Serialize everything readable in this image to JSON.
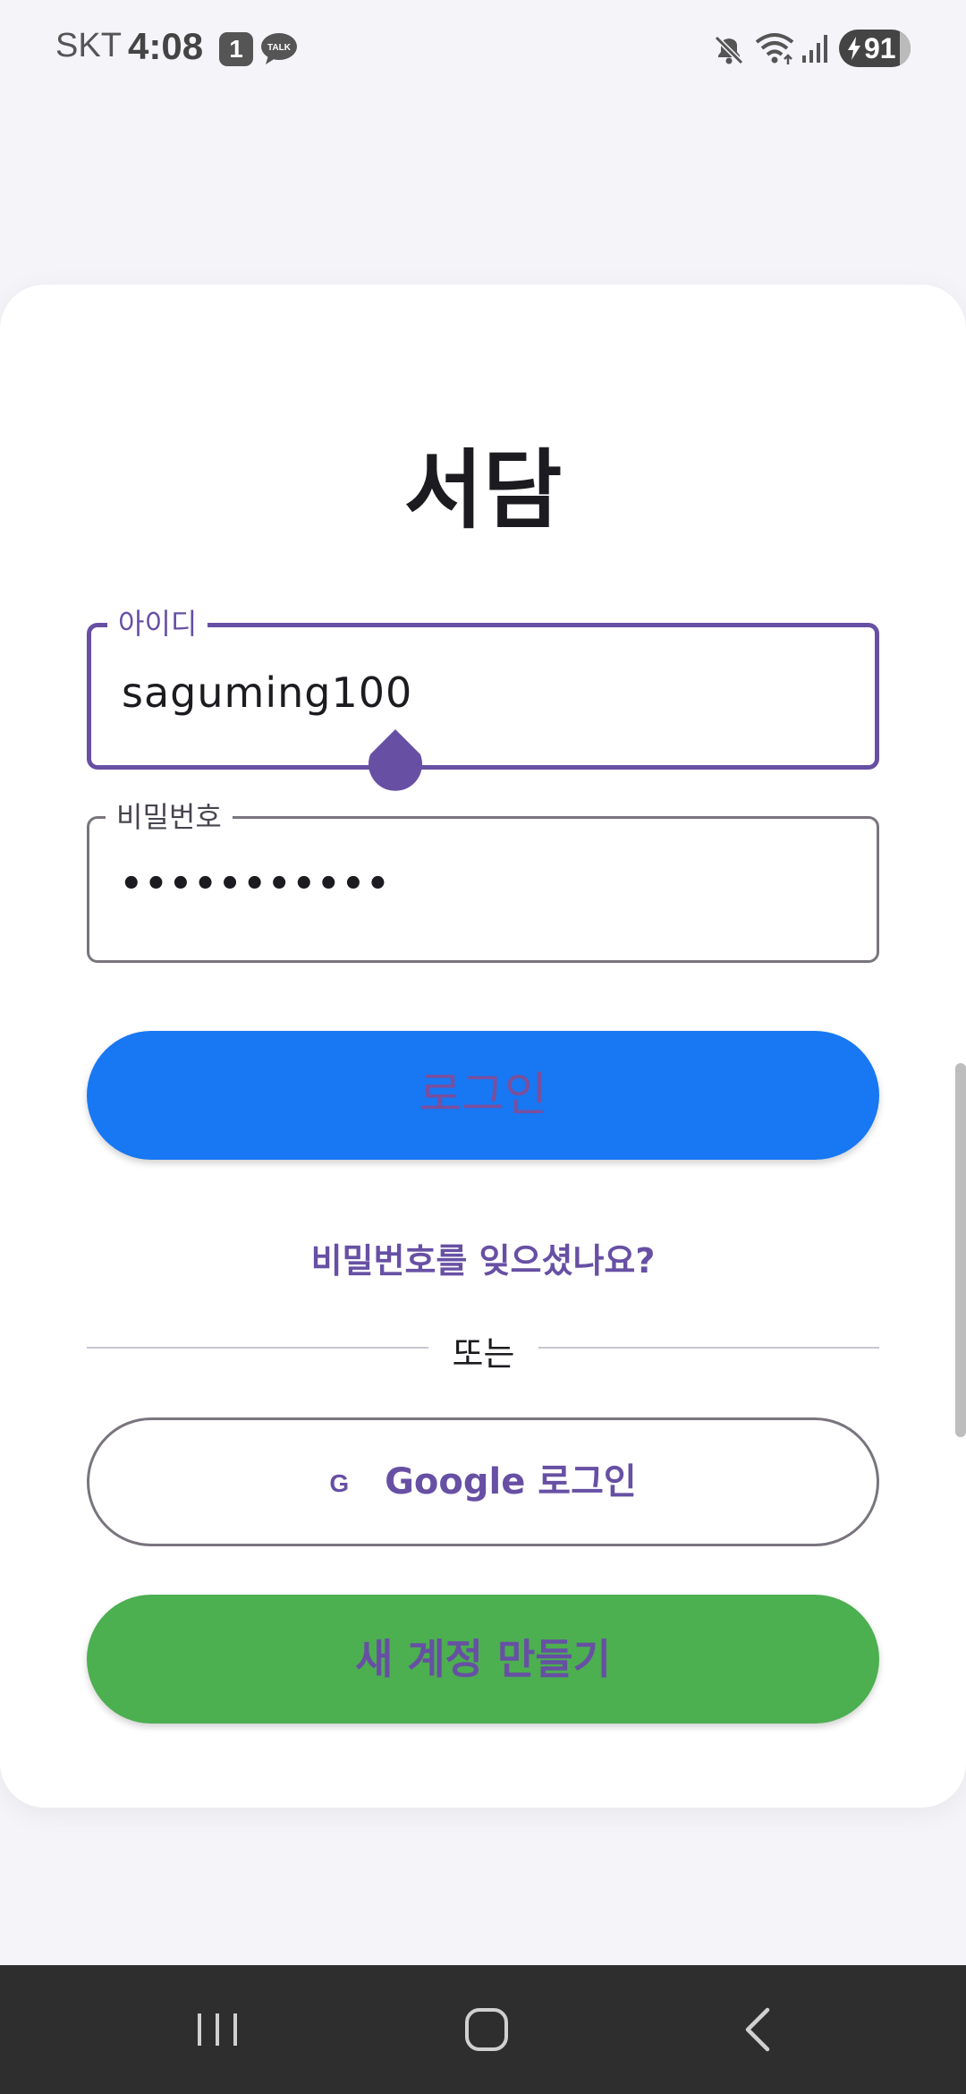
{
  "status_bar": {
    "carrier": "SKT",
    "time": "4:08",
    "notification_count": "1",
    "talk_label": "TALK",
    "battery_level": "91",
    "icons": [
      "mute-icon",
      "wifi-icon",
      "signal-icon",
      "battery-charging-icon"
    ]
  },
  "app": {
    "title": "서담"
  },
  "form": {
    "id_label": "아이디",
    "id_value": "saguming100",
    "password_label": "비밀번호",
    "password_value": "•••••••••••",
    "login_button": "로그인",
    "forgot_password": "비밀번호를 잊으셨나요?",
    "divider_text": "또는",
    "google_icon": "G",
    "google_button": "Google 로그인",
    "signup_button": "새 계정 만들기"
  },
  "colors": {
    "accent": "#6750a4",
    "login_button_bg": "#1877f2",
    "signup_button_bg": "#4caf50",
    "nav_bar_bg": "#2e2e2e"
  },
  "nav_bar": {
    "icons": [
      "recents-icon",
      "home-icon",
      "back-icon"
    ]
  }
}
